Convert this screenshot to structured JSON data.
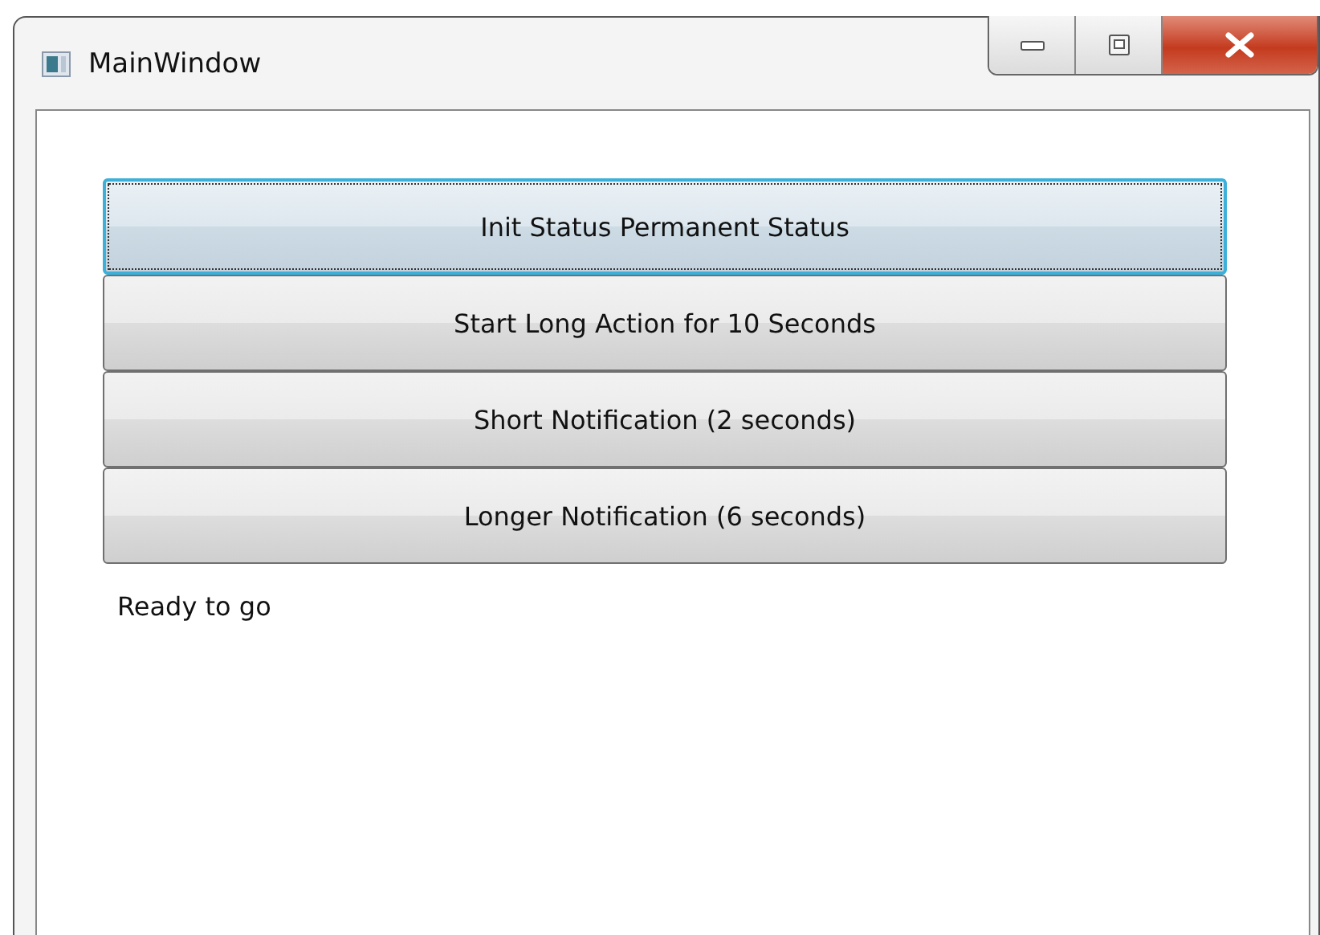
{
  "window": {
    "title": "MainWindow"
  },
  "buttons": [
    {
      "label": "Init Status Permanent Status",
      "focused": true
    },
    {
      "label": "Start Long Action for 10 Seconds",
      "focused": false
    },
    {
      "label": "Short Notification (2 seconds)",
      "focused": false
    },
    {
      "label": "Longer Notification (6 seconds)",
      "focused": false
    }
  ],
  "status_text": "Ready to go"
}
